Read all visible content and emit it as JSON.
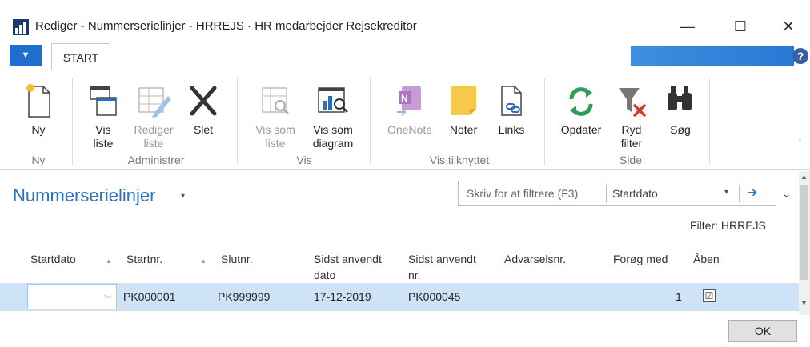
{
  "window": {
    "title": "Rediger - Nummerserielinjer - HRREJS · HR medarbejder Rejsekreditor",
    "min_glyph": "—",
    "max_glyph": "☐",
    "close_glyph": "✕"
  },
  "tabs": {
    "app_menu": "▼",
    "start": "START",
    "help": "?"
  },
  "ribbon": {
    "buttons": {
      "ny": "Ny",
      "vis_liste": "Vis\nliste",
      "rediger_liste": "Rediger\nliste",
      "slet": "Slet",
      "vis_som_liste": "Vis som\nliste",
      "vis_som_diagram": "Vis som\ndiagram",
      "onenote": "OneNote",
      "noter": "Noter",
      "links": "Links",
      "opdater": "Opdater",
      "ryd_filter": "Ryd\nfilter",
      "soeg": "Søg"
    },
    "groups": {
      "ny": "Ny",
      "administrer": "Administrer",
      "vis": "Vis",
      "vis_tilknyttet": "Vis tilknyttet",
      "side": "Side"
    }
  },
  "page": {
    "title": "Nummerserielinjer",
    "title_caret": "▾",
    "filter_placeholder": "Skriv for at filtrere (F3)",
    "filter_field": "Startdato",
    "filter_dropdown": "▾",
    "filter_go": "➔",
    "collapse": "⌄",
    "filter_info": "Filter: HRREJS"
  },
  "table": {
    "columns": {
      "startdato": "Startdato",
      "startnr": "Startnr.",
      "slutnr": "Slutnr.",
      "sidst_anvendt_dato": "Sidst anvendt\ndato",
      "sidst_anvendt_nr": "Sidst anvendt\nnr.",
      "advarselsnr": "Advarselsnr.",
      "foroeg_med": "Forøg med",
      "aaben": "Åben"
    },
    "rows": [
      {
        "startdato": "",
        "startnr": "PK000001",
        "slutnr": "PK999999",
        "sidst_anvendt_dato": "17-12-2019",
        "sidst_anvendt_nr": "PK000045",
        "advarselsnr": "",
        "foroeg_med": "1",
        "aaben": "☑"
      }
    ]
  },
  "footer": {
    "ok": "OK"
  }
}
